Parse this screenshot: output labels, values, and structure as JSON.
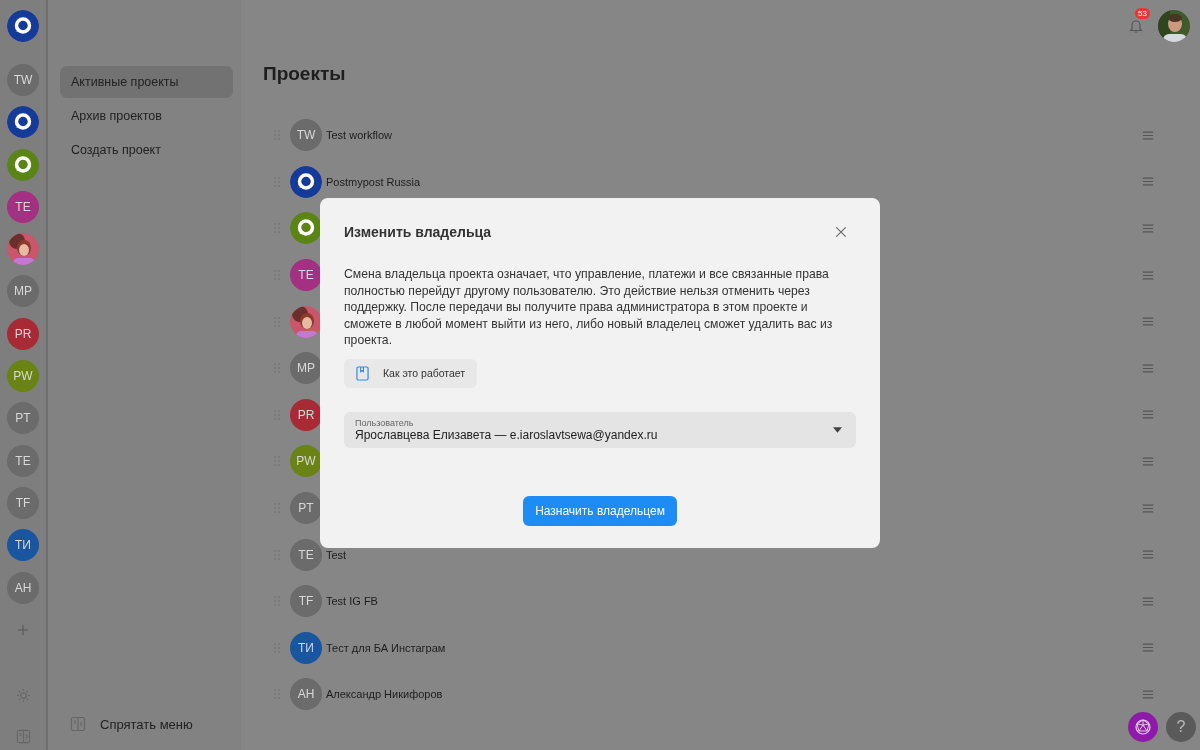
{
  "rail": {
    "logo": {
      "kind": "logo",
      "color": "#143a9a"
    },
    "projects": [
      {
        "kind": "initials",
        "initials": "TW",
        "color": "#6b6b6b"
      },
      {
        "kind": "logo",
        "color": "#143a9a"
      },
      {
        "kind": "logo",
        "color": "#5a8413"
      },
      {
        "kind": "initials",
        "initials": "TE",
        "color": "#a33080"
      },
      {
        "kind": "picture"
      },
      {
        "kind": "initials",
        "initials": "MP",
        "color": "#6b6b6b"
      },
      {
        "kind": "initials",
        "initials": "PR",
        "color": "#a82a35"
      },
      {
        "kind": "initials",
        "initials": "PW",
        "color": "#6a8314"
      },
      {
        "kind": "initials",
        "initials": "PT",
        "color": "#6b6b6b"
      },
      {
        "kind": "initials",
        "initials": "TE",
        "color": "#6b6b6b"
      },
      {
        "kind": "initials",
        "initials": "TF",
        "color": "#6b6b6b"
      },
      {
        "kind": "initials",
        "initials": "ТИ",
        "color": "#1a55a0"
      },
      {
        "kind": "initials",
        "initials": "AH",
        "color": "#6b6b6b"
      }
    ]
  },
  "menu": {
    "items": [
      {
        "label": "Активные проекты",
        "selected": true
      },
      {
        "label": "Архив проектов",
        "selected": false
      },
      {
        "label": "Создать проект",
        "selected": false
      }
    ],
    "hide_menu": "Спрятать меню"
  },
  "topbar": {
    "notifications": "53"
  },
  "main": {
    "title": "Проекты",
    "projects": [
      {
        "kind": "initials",
        "initials": "TW",
        "color": "#6b6b6b",
        "name": "Test workflow"
      },
      {
        "kind": "logo",
        "color": "#143a9a",
        "name": "Postmypost Russia"
      },
      {
        "kind": "logo",
        "color": "#5a8413"
      },
      {
        "kind": "initials",
        "initials": "TE",
        "color": "#a33080"
      },
      {
        "kind": "picture"
      },
      {
        "kind": "initials",
        "initials": "MP",
        "color": "#6b6b6b"
      },
      {
        "kind": "initials",
        "initials": "PR",
        "color": "#a82a35"
      },
      {
        "kind": "initials",
        "initials": "PW",
        "color": "#6a8314"
      },
      {
        "kind": "initials",
        "initials": "PT",
        "color": "#6b6b6b"
      },
      {
        "kind": "initials",
        "initials": "TE",
        "color": "#6b6b6b",
        "name": "Test"
      },
      {
        "kind": "initials",
        "initials": "TF",
        "color": "#6b6b6b",
        "name": "Test IG FB"
      },
      {
        "kind": "initials",
        "initials": "ТИ",
        "color": "#1a55a0",
        "name": "Тест для БА Инстаграм"
      },
      {
        "kind": "initials",
        "initials": "AH",
        "color": "#6b6b6b",
        "name": "Александр Никифоров"
      }
    ]
  },
  "help": "?",
  "modal": {
    "title": "Изменить владельца",
    "body": "Смена владельца проекта означает, что управление, платежи и все связанные права полностью перейдут другому пользователю. Это действие нельзя отменить через поддержку. После передачи вы получите права администратора в этом проекте и сможете в любой момент выйти из него, либо новый владелец сможет удалить вас из проекта.",
    "help_button": "Как это работает",
    "field": {
      "label": "Пользователь",
      "value": "Ярославцева Елизавета  — e.iaroslavtsewa@yandex.ru"
    },
    "submit": "Назначить владельцем"
  }
}
